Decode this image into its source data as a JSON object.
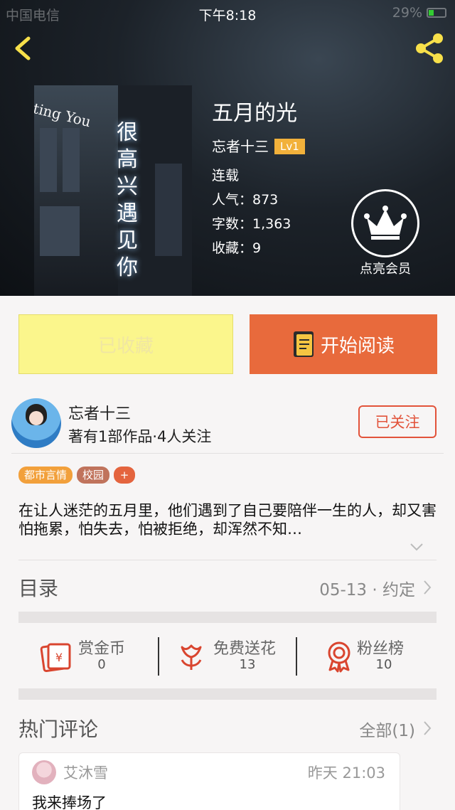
{
  "status_bar": {
    "carrier": "中国电信",
    "time": "下午8:18",
    "battery": "29%"
  },
  "book": {
    "cover_text_en": "ting You",
    "cover_text_cn": [
      "很",
      "高",
      "兴",
      "遇",
      "见",
      "你"
    ],
    "title": "五月的光",
    "author": "忘者十三",
    "level": "Lv1",
    "status": "连载",
    "popularity": "人气：873",
    "word_count": "字数：1,363",
    "favorites": "收藏：9"
  },
  "vip": {
    "label": "点亮会员",
    "icon": "crown-icon"
  },
  "actions": {
    "favorited_label": "已收藏",
    "read_label": "开始阅读"
  },
  "author_card": {
    "name": "忘者十三",
    "stats": "著有1部作品·4人关注",
    "follow_label": "已关注"
  },
  "tags": [
    "都市言情",
    "校园",
    "+"
  ],
  "description": "在让人迷茫的五月里，他们遇到了自己要陪伴一生的人，却又害怕拖累，怕失去，怕被拒绝，却浑然不知…",
  "toc": {
    "label": "目录",
    "latest": "05-13 · 约定"
  },
  "rewards": [
    {
      "label": "赏金币",
      "count": "0",
      "icon": "red-envelope-icon"
    },
    {
      "label": "免费送花",
      "count": "13",
      "icon": "flower-icon"
    },
    {
      "label": "粉丝榜",
      "count": "10",
      "icon": "medal-icon"
    }
  ],
  "comments": {
    "title": "热门评论",
    "all_label": "全部(1)",
    "items": [
      {
        "user": "艾沐雪",
        "time": "昨天 21:03",
        "text": "我来捧场了"
      }
    ]
  },
  "colors": {
    "accent": "#e86a3c",
    "favorite_bg": "#fbf68c",
    "follow": "#e2533a",
    "level_badge": "#f2b13b",
    "icon_red": "#d9452f"
  }
}
